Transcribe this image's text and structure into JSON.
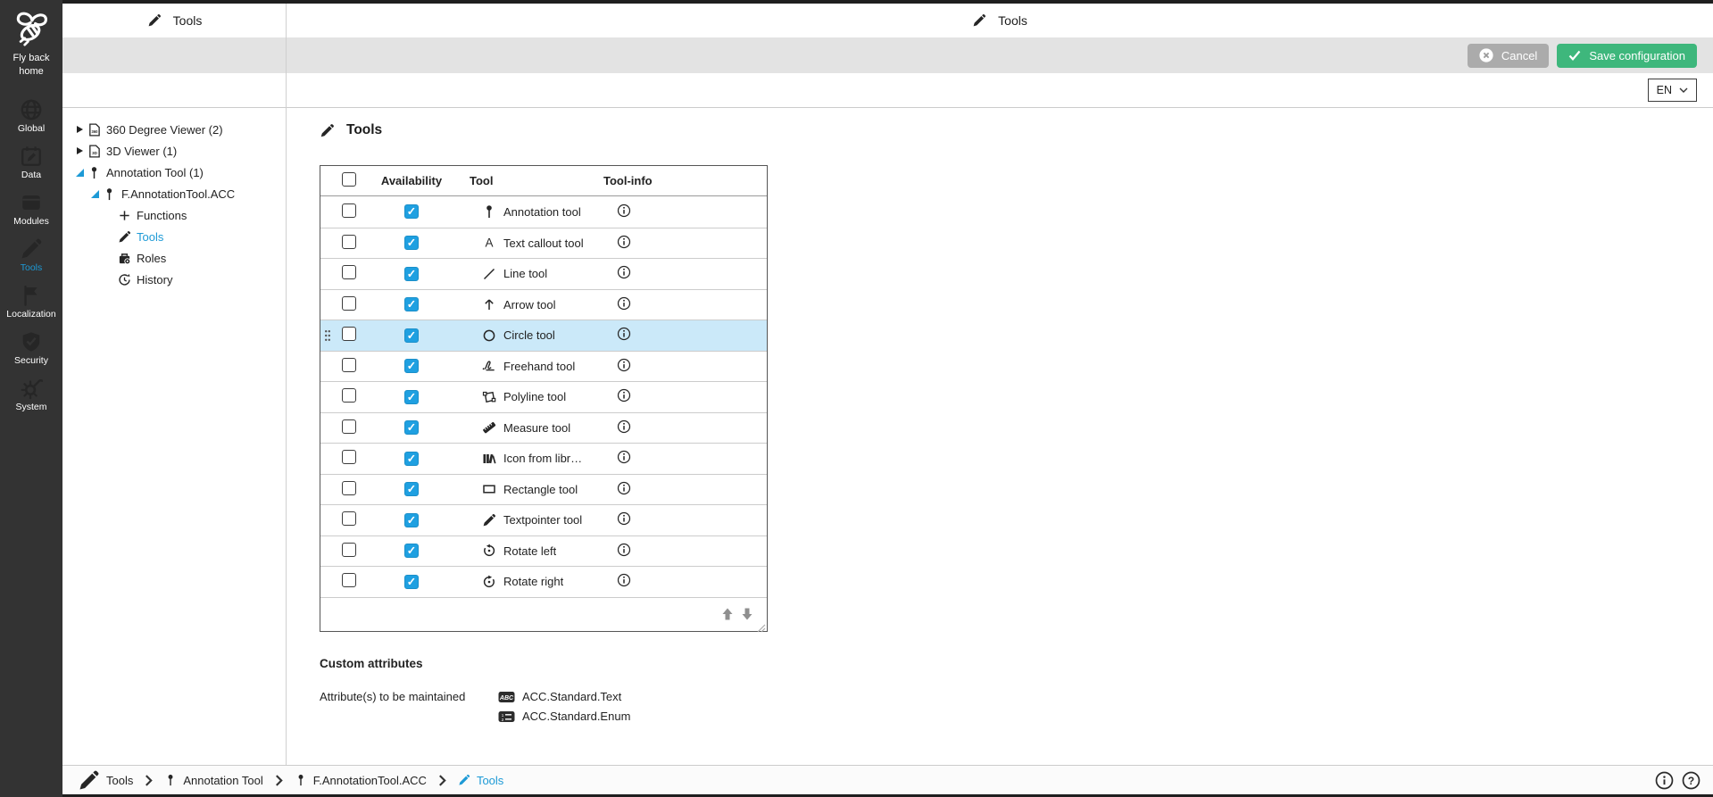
{
  "app": {
    "panel_header": {
      "title": "Tools",
      "icon": "pencil-icon"
    },
    "main_header": {
      "title": "Tools",
      "icon": "pencil-icon"
    },
    "toolbar": {
      "cancel_label": "Cancel",
      "cancel_icon": "x-circle-icon",
      "save_label": "Save configuration",
      "save_icon": "check-icon"
    },
    "language": {
      "selected": "EN",
      "chevron_icon": "chevron-down-icon"
    }
  },
  "sidebar": {
    "logo": {
      "label": "Fly back home",
      "icon": "bee-logo-icon"
    },
    "items": [
      {
        "id": "global",
        "label": "Global",
        "icon": "globe-icon",
        "active": false
      },
      {
        "id": "data",
        "label": "Data",
        "icon": "calendar-pencil-icon",
        "active": false
      },
      {
        "id": "modules",
        "label": "Modules",
        "icon": "box-icon",
        "active": false
      },
      {
        "id": "tools",
        "label": "Tools",
        "icon": "pencil-icon",
        "active": true
      },
      {
        "id": "localization",
        "label": "Localization",
        "icon": "flag-icon",
        "active": false
      },
      {
        "id": "security",
        "label": "Security",
        "icon": "shield-check-icon",
        "active": false
      },
      {
        "id": "system",
        "label": "System",
        "icon": "gear-wrench-icon",
        "active": false
      }
    ]
  },
  "tree": {
    "items": [
      {
        "label": "360 Degree Viewer (2)",
        "icon": "document-360-icon",
        "level": 0,
        "state": "collapsed",
        "active": false
      },
      {
        "label": "3D Viewer (1)",
        "icon": "document-3d-icon",
        "level": 0,
        "state": "collapsed",
        "active": false
      },
      {
        "label": "Annotation Tool (1)",
        "icon": "pin-icon",
        "level": 0,
        "state": "expanded",
        "active": false
      },
      {
        "label": "F.AnnotationTool.ACC",
        "icon": "pin-icon",
        "level": 1,
        "state": "expanded",
        "active": false
      },
      {
        "label": "Functions",
        "icon": "plus-icon",
        "level": 2,
        "state": "leaf",
        "active": false
      },
      {
        "label": "Tools",
        "icon": "pencil-icon",
        "level": 2,
        "state": "leaf",
        "active": true
      },
      {
        "label": "Roles",
        "icon": "roles-icon",
        "level": 2,
        "state": "leaf",
        "active": false
      },
      {
        "label": "History",
        "icon": "history-icon",
        "level": 2,
        "state": "leaf",
        "active": false
      }
    ]
  },
  "content": {
    "page_title": "Tools",
    "page_title_icon": "pencil-icon",
    "table": {
      "columns": [
        "Availability",
        "Tool",
        "Tool-info"
      ],
      "info_icon": "info-icon",
      "footer_icons": [
        "move-up-icon",
        "move-down-icon"
      ],
      "rows": [
        {
          "tool": "Annotation tool",
          "icon": "pin-icon",
          "selected": false,
          "available": true,
          "highlighted": false
        },
        {
          "tool": "Text callout tool",
          "icon": "text-callout-icon",
          "selected": false,
          "available": true,
          "highlighted": false
        },
        {
          "tool": "Line tool",
          "icon": "line-icon",
          "selected": false,
          "available": true,
          "highlighted": false
        },
        {
          "tool": "Arrow tool",
          "icon": "arrow-up-icon",
          "selected": false,
          "available": true,
          "highlighted": false
        },
        {
          "tool": "Circle tool",
          "icon": "circle-icon",
          "selected": false,
          "available": true,
          "highlighted": true
        },
        {
          "tool": "Freehand tool",
          "icon": "freehand-icon",
          "selected": false,
          "available": true,
          "highlighted": false
        },
        {
          "tool": "Polyline tool",
          "icon": "polyline-icon",
          "selected": false,
          "available": true,
          "highlighted": false
        },
        {
          "tool": "Measure tool",
          "icon": "measure-icon",
          "selected": false,
          "available": true,
          "highlighted": false
        },
        {
          "tool": "Icon from libr…",
          "icon": "library-icon",
          "selected": false,
          "available": true,
          "highlighted": false
        },
        {
          "tool": "Rectangle tool",
          "icon": "rectangle-icon",
          "selected": false,
          "available": true,
          "highlighted": false
        },
        {
          "tool": "Textpointer tool",
          "icon": "pencil-icon",
          "selected": false,
          "available": true,
          "highlighted": false
        },
        {
          "tool": "Rotate left",
          "icon": "rotate-left-icon",
          "selected": false,
          "available": true,
          "highlighted": false
        },
        {
          "tool": "Rotate right",
          "icon": "rotate-right-icon",
          "selected": false,
          "available": true,
          "highlighted": false
        }
      ]
    },
    "custom_attributes": {
      "title": "Custom attributes",
      "label": "Attribute(s) to be maintained",
      "values": [
        {
          "name": "ACC.Standard.Text",
          "icon": "abc-attribute-icon"
        },
        {
          "name": "ACC.Standard.Enum",
          "icon": "enum-attribute-icon"
        }
      ]
    }
  },
  "breadcrumb": {
    "items": [
      {
        "label": "Tools",
        "icon": "pencil-icon",
        "large_icon": true,
        "active": false
      },
      {
        "label": "Annotation Tool",
        "icon": "pin-icon",
        "large_icon": false,
        "active": false
      },
      {
        "label": "F.AnnotationTool.ACC",
        "icon": "pin-icon",
        "large_icon": false,
        "active": false
      },
      {
        "label": "Tools",
        "icon": "pencil-icon",
        "large_icon": false,
        "active": true
      }
    ],
    "separator_icon": "chevron-right-icon"
  },
  "statusbar": {
    "icons": [
      "info-circle-icon",
      "help-circle-icon"
    ]
  },
  "colors": {
    "accent_blue": "#1d9ad6",
    "checkbox_blue": "#1fa0e1",
    "highlight_row": "#cbe9f9",
    "save_green": "#3eb77c",
    "cancel_gray": "#ababab",
    "sidebar_bg": "#333333",
    "toolbar_gray": "#e3e3e3"
  }
}
